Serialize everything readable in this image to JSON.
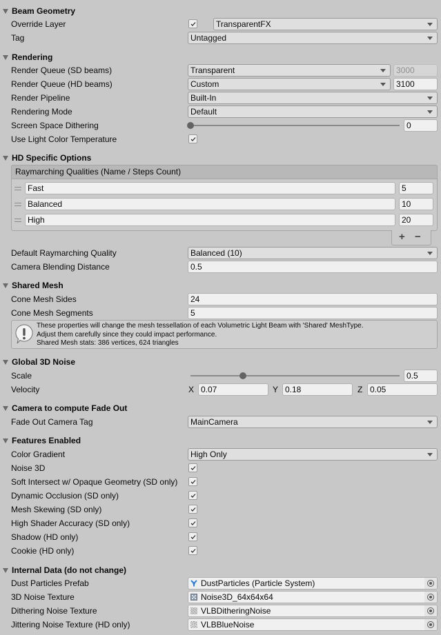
{
  "sections": {
    "beam_geometry": {
      "title": "Beam Geometry",
      "override_layer": {
        "label": "Override Layer",
        "checked": true,
        "value": "TransparentFX"
      },
      "tag": {
        "label": "Tag",
        "value": "Untagged"
      }
    },
    "rendering": {
      "title": "Rendering",
      "render_queue_sd": {
        "label": "Render Queue (SD beams)",
        "value": "Transparent",
        "number": "3000"
      },
      "render_queue_hd": {
        "label": "Render Queue (HD beams)",
        "value": "Custom",
        "number": "3100"
      },
      "render_pipeline": {
        "label": "Render Pipeline",
        "value": "Built-In"
      },
      "rendering_mode": {
        "label": "Rendering Mode",
        "value": "Default"
      },
      "screen_space_dithering": {
        "label": "Screen Space Dithering",
        "value": "0",
        "slider_fraction": 0.0
      },
      "use_light_color_temperature": {
        "label": "Use Light Color Temperature",
        "checked": true
      }
    },
    "hd_specific": {
      "title": "HD Specific Options",
      "list_header": "Raymarching Qualities (Name / Steps Count)",
      "qualities": [
        {
          "name": "Fast",
          "steps": "5"
        },
        {
          "name": "Balanced",
          "steps": "10"
        },
        {
          "name": "High",
          "steps": "20"
        }
      ],
      "add_label": "+",
      "remove_label": "−",
      "default_quality": {
        "label": "Default Raymarching Quality",
        "value": "Balanced (10)"
      },
      "camera_blending_distance": {
        "label": "Camera Blending Distance",
        "value": "0.5"
      }
    },
    "shared_mesh": {
      "title": "Shared Mesh",
      "cone_mesh_sides": {
        "label": "Cone Mesh Sides",
        "value": "24"
      },
      "cone_mesh_segments": {
        "label": "Cone Mesh Segments",
        "value": "5"
      },
      "help_lines": [
        "These properties will change the mesh tessellation of each Volumetric Light Beam with 'Shared' MeshType.",
        "Adjust them carefully since they could impact performance.",
        "Shared Mesh stats: 386 vertices, 624 triangles"
      ]
    },
    "global_noise": {
      "title": "Global 3D Noise",
      "scale": {
        "label": "Scale",
        "value": "0.5",
        "slider_fraction": 0.25
      },
      "velocity": {
        "label": "Velocity",
        "x_label": "X",
        "x": "0.07",
        "y_label": "Y",
        "y": "0.18",
        "z_label": "Z",
        "z": "0.05"
      }
    },
    "fade_out": {
      "title": "Camera to compute Fade Out",
      "camera_tag": {
        "label": "Fade Out Camera Tag",
        "value": "MainCamera"
      }
    },
    "features": {
      "title": "Features Enabled",
      "color_gradient": {
        "label": "Color Gradient",
        "value": "High Only"
      },
      "toggles": [
        {
          "label": "Noise 3D",
          "checked": true
        },
        {
          "label": "Soft Intersect w/ Opaque Geometry (SD only)",
          "checked": true
        },
        {
          "label": "Dynamic Occlusion (SD only)",
          "checked": true
        },
        {
          "label": "Mesh Skewing (SD only)",
          "checked": true
        },
        {
          "label": "High Shader Accuracy (SD only)",
          "checked": true
        },
        {
          "label": "Shadow (HD only)",
          "checked": true
        },
        {
          "label": "Cookie (HD only)",
          "checked": true
        }
      ]
    },
    "internal_data": {
      "title": "Internal Data (do not change)",
      "fields": [
        {
          "label": "Dust Particles Prefab",
          "value": "DustParticles (Particle System)",
          "icon": "particle-system-icon"
        },
        {
          "label": "3D Noise Texture",
          "value": "Noise3D_64x64x64",
          "icon": "texture3d-icon"
        },
        {
          "label": "Dithering Noise Texture",
          "value": "VLBDitheringNoise",
          "icon": "texture-icon"
        },
        {
          "label": "Jittering Noise Texture (HD only)",
          "value": "VLBBlueNoise",
          "icon": "texture-icon"
        }
      ]
    }
  },
  "colors": {
    "panel_bg": "#c8c8c8",
    "field_bg": "#f0f0f0",
    "dropdown_bg": "#dfdfdf",
    "particle_icon": "#2f7fe0"
  }
}
